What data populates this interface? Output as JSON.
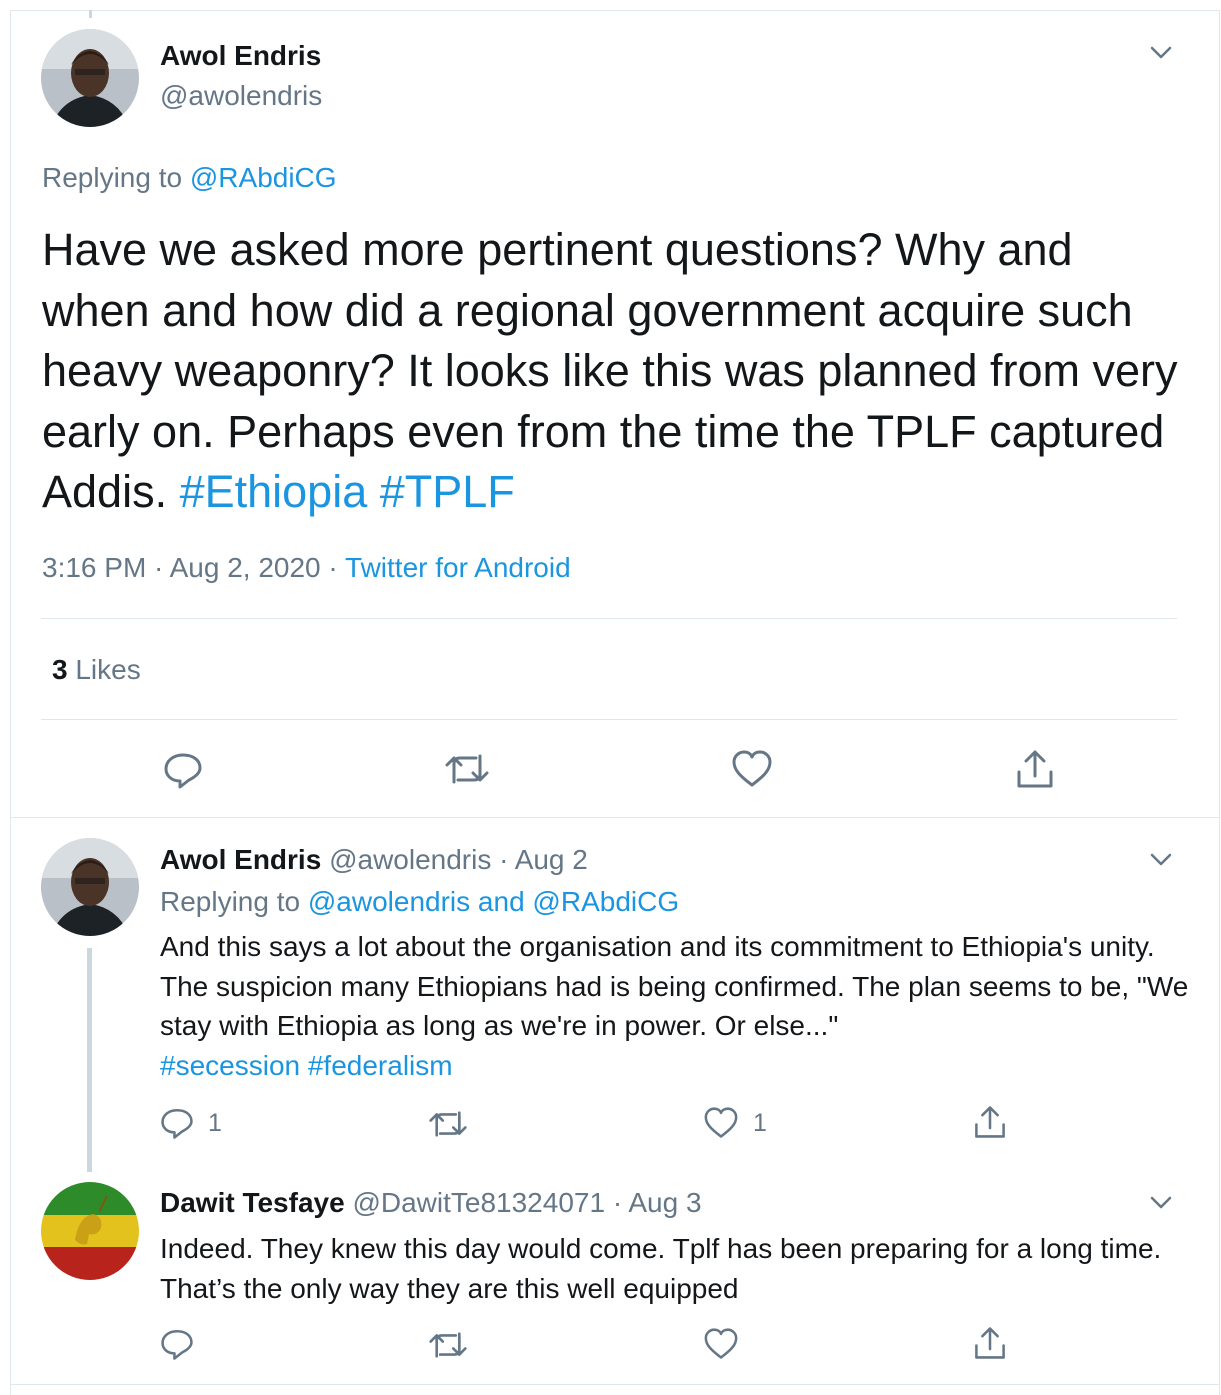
{
  "colors": {
    "link": "#1b95e0",
    "secondary": "#657786",
    "text": "#14171a",
    "border": "#e1e8ed"
  },
  "main": {
    "name": "Awol Endris",
    "handle": "@awolendris",
    "replying_label": "Replying to ",
    "replying_to": "@RAbdiCG",
    "text": "Have we asked more pertinent questions? Why and when and how did a regional government acquire such heavy weaponry? It looks like this was planned from very early on. Perhaps even from the time the TPLF captured Addis. ",
    "hashtags": "#Ethiopia #TPLF",
    "time": "3:16 PM · Aug 2, 2020 · ",
    "source": "Twitter for Android",
    "likes_count": "3",
    "likes_label": " Likes",
    "icons": [
      "reply-icon",
      "retweet-icon",
      "like-icon",
      "share-icon",
      "chevron-down-icon"
    ]
  },
  "replies": [
    {
      "name": "Awol Endris",
      "handle": "@awolendris · Aug 2",
      "replying_label": "Replying to ",
      "replying_to": "@awolendris and @RAbdiCG",
      "text": "And this says a lot about the organisation and its commitment to Ethiopia's unity. The suspicion many Ethiopians had is being confirmed. The plan seems to be, \"We stay with Ethiopia as long as we're in power. Or else...\"",
      "hashtags": "#secession #federalism",
      "reply_count": "1",
      "like_count": "1"
    },
    {
      "name": "Dawit Tesfaye",
      "handle": "@DawitTe81324071 · Aug 3",
      "text": "Indeed. They knew this day would come. Tplf has been preparing for a long time. That’s the only way they are this well equipped"
    }
  ]
}
